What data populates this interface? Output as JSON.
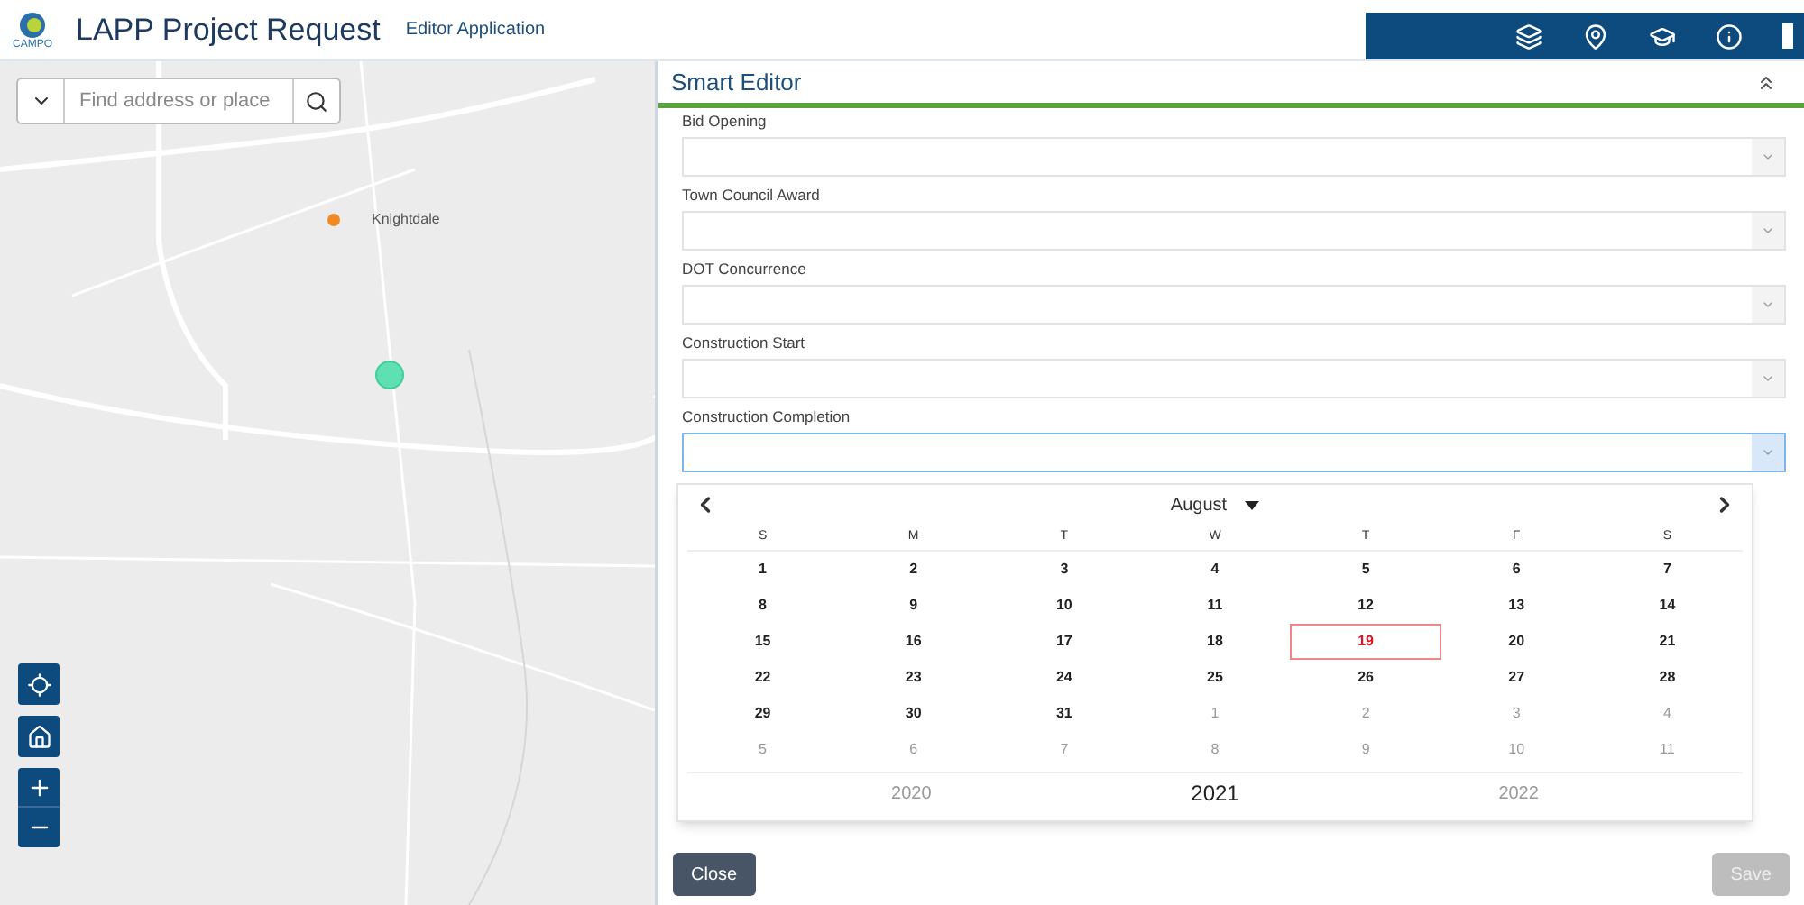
{
  "header": {
    "logo_text": "CAMPO",
    "title": "LAPP Project Request",
    "subtitle": "Editor Application"
  },
  "search": {
    "placeholder": "Find address or place"
  },
  "map": {
    "place_label": "Knightdale"
  },
  "panel": {
    "title": "Smart Editor",
    "fields": [
      {
        "label": "Bid Opening",
        "focused": false
      },
      {
        "label": "Town Council Award",
        "focused": false
      },
      {
        "label": "DOT Concurrence",
        "focused": false
      },
      {
        "label": "Construction Start",
        "focused": false
      },
      {
        "label": "Construction Completion",
        "focused": true
      }
    ]
  },
  "calendar": {
    "month": "August",
    "weekdays": [
      "S",
      "M",
      "T",
      "W",
      "T",
      "F",
      "S"
    ],
    "weeks": [
      [
        {
          "day": "1",
          "outside": false,
          "selected": false
        },
        {
          "day": "2",
          "outside": false,
          "selected": false
        },
        {
          "day": "3",
          "outside": false,
          "selected": false
        },
        {
          "day": "4",
          "outside": false,
          "selected": false
        },
        {
          "day": "5",
          "outside": false,
          "selected": false
        },
        {
          "day": "6",
          "outside": false,
          "selected": false
        },
        {
          "day": "7",
          "outside": false,
          "selected": false
        }
      ],
      [
        {
          "day": "8",
          "outside": false,
          "selected": false
        },
        {
          "day": "9",
          "outside": false,
          "selected": false
        },
        {
          "day": "10",
          "outside": false,
          "selected": false
        },
        {
          "day": "11",
          "outside": false,
          "selected": false
        },
        {
          "day": "12",
          "outside": false,
          "selected": false
        },
        {
          "day": "13",
          "outside": false,
          "selected": false
        },
        {
          "day": "14",
          "outside": false,
          "selected": false
        }
      ],
      [
        {
          "day": "15",
          "outside": false,
          "selected": false
        },
        {
          "day": "16",
          "outside": false,
          "selected": false
        },
        {
          "day": "17",
          "outside": false,
          "selected": false
        },
        {
          "day": "18",
          "outside": false,
          "selected": false
        },
        {
          "day": "19",
          "outside": false,
          "selected": true
        },
        {
          "day": "20",
          "outside": false,
          "selected": false
        },
        {
          "day": "21",
          "outside": false,
          "selected": false
        }
      ],
      [
        {
          "day": "22",
          "outside": false,
          "selected": false
        },
        {
          "day": "23",
          "outside": false,
          "selected": false
        },
        {
          "day": "24",
          "outside": false,
          "selected": false
        },
        {
          "day": "25",
          "outside": false,
          "selected": false
        },
        {
          "day": "26",
          "outside": false,
          "selected": false
        },
        {
          "day": "27",
          "outside": false,
          "selected": false
        },
        {
          "day": "28",
          "outside": false,
          "selected": false
        }
      ],
      [
        {
          "day": "29",
          "outside": false,
          "selected": false
        },
        {
          "day": "30",
          "outside": false,
          "selected": false
        },
        {
          "day": "31",
          "outside": false,
          "selected": false
        },
        {
          "day": "1",
          "outside": true,
          "selected": false
        },
        {
          "day": "2",
          "outside": true,
          "selected": false
        },
        {
          "day": "3",
          "outside": true,
          "selected": false
        },
        {
          "day": "4",
          "outside": true,
          "selected": false
        }
      ],
      [
        {
          "day": "5",
          "outside": true,
          "selected": false
        },
        {
          "day": "6",
          "outside": true,
          "selected": false
        },
        {
          "day": "7",
          "outside": true,
          "selected": false
        },
        {
          "day": "8",
          "outside": true,
          "selected": false
        },
        {
          "day": "9",
          "outside": true,
          "selected": false
        },
        {
          "day": "10",
          "outside": true,
          "selected": false
        },
        {
          "day": "11",
          "outside": true,
          "selected": false
        }
      ]
    ],
    "years": [
      {
        "label": "2020",
        "selected": false
      },
      {
        "label": "2021",
        "selected": true
      },
      {
        "label": "2022",
        "selected": false
      }
    ]
  },
  "buttons": [
    {
      "label": "Close",
      "disabled": false
    },
    {
      "label": "Save",
      "disabled": true
    }
  ]
}
